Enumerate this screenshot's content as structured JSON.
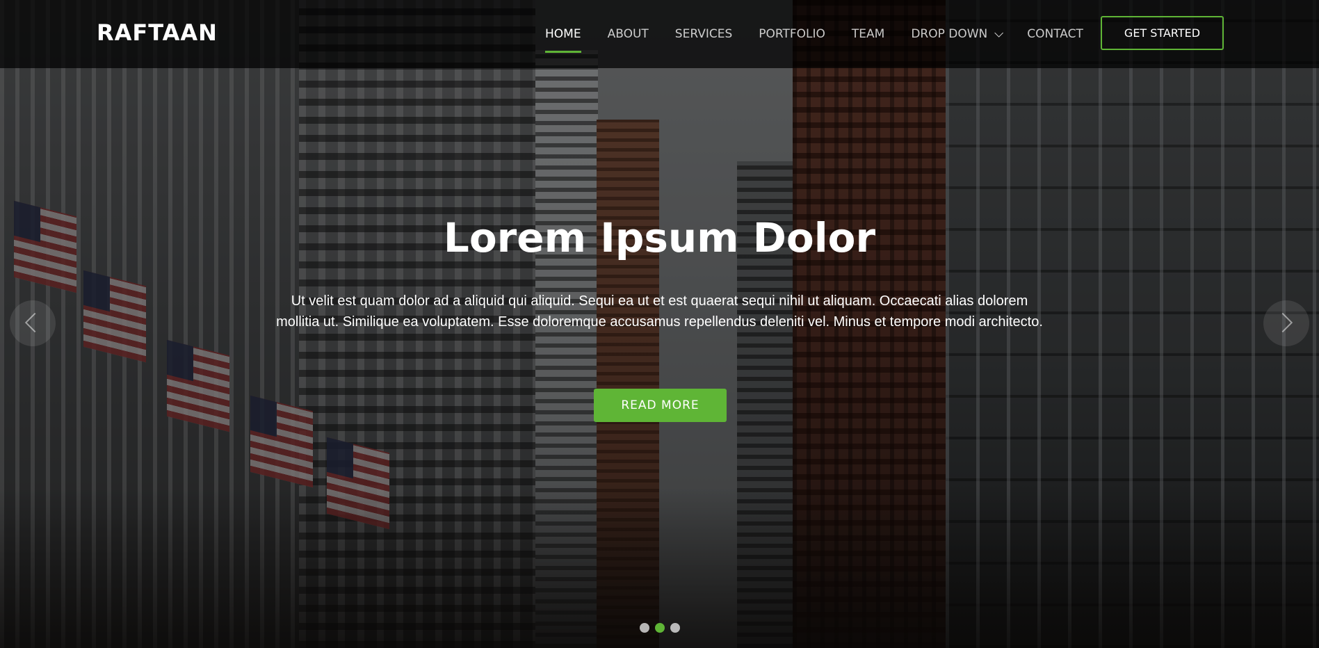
{
  "brand": {
    "name": "RAFTAAN"
  },
  "nav": {
    "items": [
      {
        "label": "HOME",
        "active": true
      },
      {
        "label": "ABOUT",
        "active": false
      },
      {
        "label": "SERVICES",
        "active": false
      },
      {
        "label": "PORTFOLIO",
        "active": false
      },
      {
        "label": "TEAM",
        "active": false
      },
      {
        "label": "DROP DOWN",
        "active": false,
        "has_dropdown": true
      },
      {
        "label": "CONTACT",
        "active": false
      }
    ],
    "cta_label": "GET STARTED"
  },
  "hero": {
    "title": "Lorem Ipsum Dolor",
    "description": "Ut velit est quam dolor ad a aliquid qui aliquid. Sequi ea ut et est quaerat sequi nihil ut aliquam. Occaecati alias dolorem mollitia ut. Similique ea voluptatem. Esse doloremque accusamus repellendus deleniti vel. Minus et tempore modi architecto.",
    "button_label": "READ MORE"
  },
  "carousel": {
    "slide_count": 3,
    "active_index": 1,
    "prev_icon": "chevron-left-icon",
    "next_icon": "chevron-right-icon"
  },
  "colors": {
    "accent": "#5fb536",
    "header_bg": "#000000",
    "text": "#ffffff"
  }
}
